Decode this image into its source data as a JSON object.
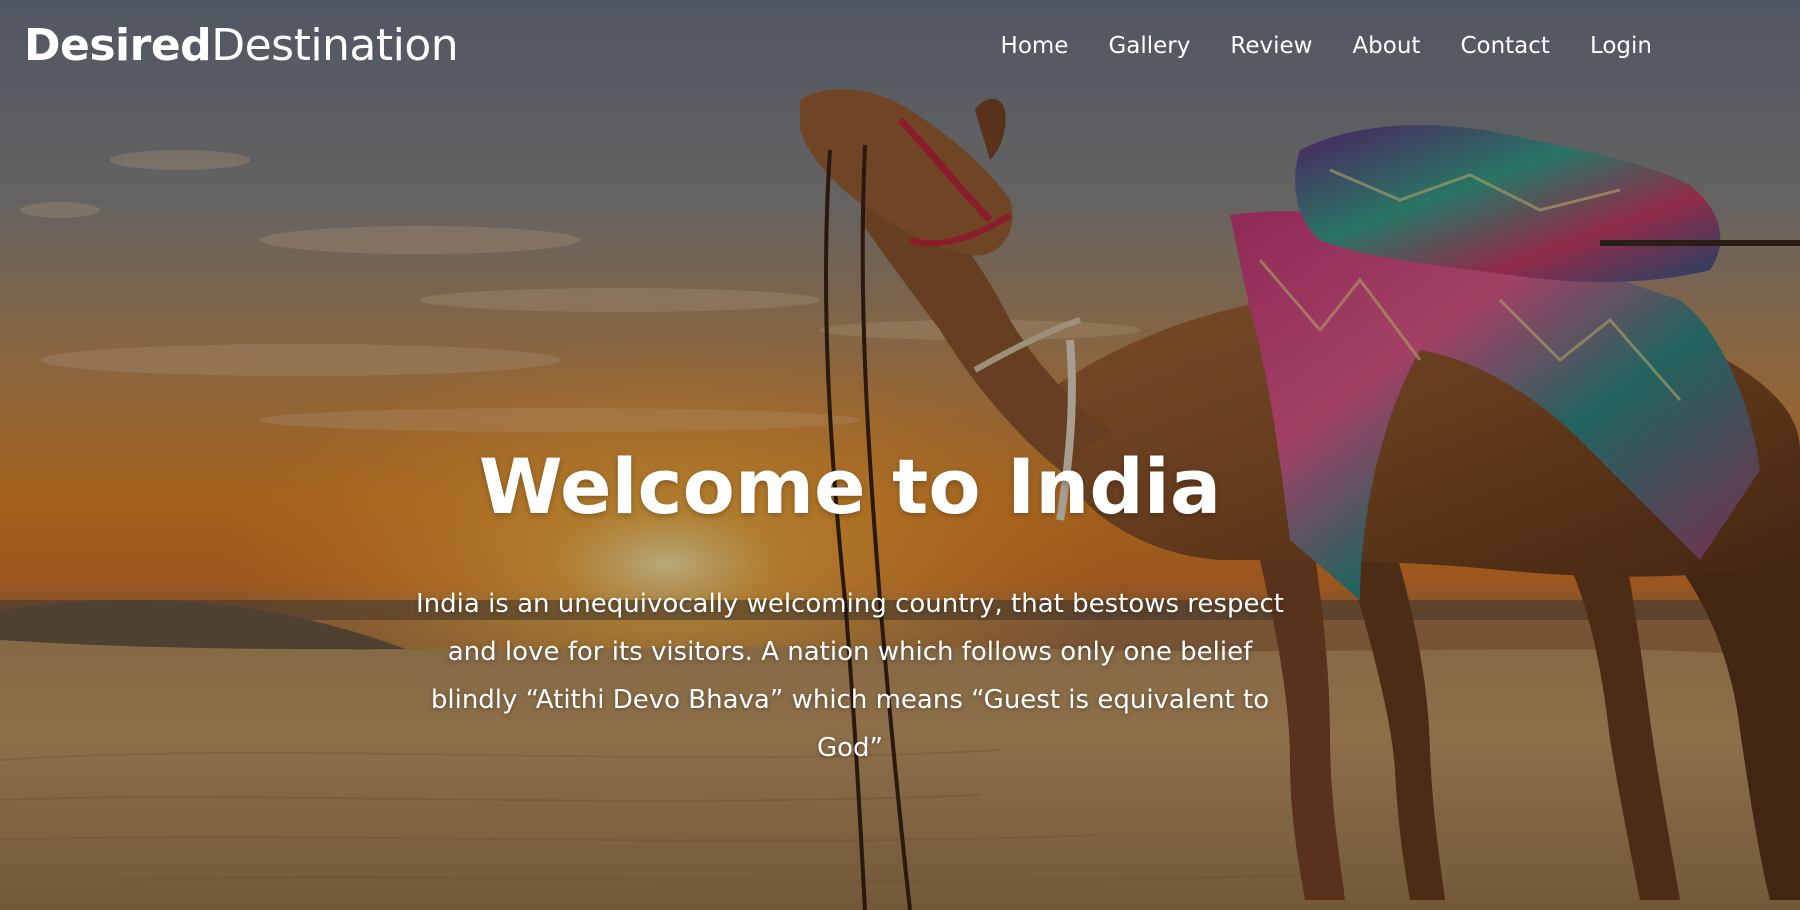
{
  "brand": {
    "bold": "Desired",
    "light": "Destination"
  },
  "nav": {
    "items": [
      {
        "label": "Home"
      },
      {
        "label": "Gallery"
      },
      {
        "label": "Review"
      },
      {
        "label": "About"
      },
      {
        "label": "Contact"
      },
      {
        "label": "Login"
      }
    ]
  },
  "hero": {
    "title": "Welcome to India",
    "text": "India is an unequivocally welcoming country, that bestows respect and love for its visitors. A nation which follows only one belief blindly “Atithi Devo Bhava” which means “Guest is equivalent to God”"
  },
  "colors": {
    "text": "#ffffff",
    "sky_top": "#6a7282",
    "sunset": "#e88a2a",
    "sand": "#c79a63",
    "overlay": "#000000"
  }
}
